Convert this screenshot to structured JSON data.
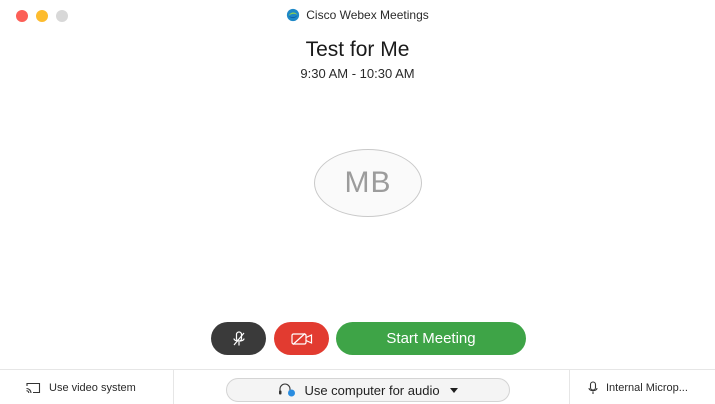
{
  "window": {
    "title": "Cisco Webex Meetings"
  },
  "meeting": {
    "title": "Test for Me",
    "time": "9:30 AM - 10:30 AM",
    "avatar_initials": "MB"
  },
  "controls": {
    "mute_icon": "mic-off-icon",
    "video_icon": "video-off-icon",
    "start_label": "Start Meeting"
  },
  "bottombar": {
    "video_system_label": "Use video system",
    "audio_label": "Use computer for audio",
    "microphone_label": "Internal Microp..."
  },
  "colors": {
    "start_green": "#3ea447",
    "video_red": "#e23b30",
    "mute_dark": "#3a3a3a"
  }
}
